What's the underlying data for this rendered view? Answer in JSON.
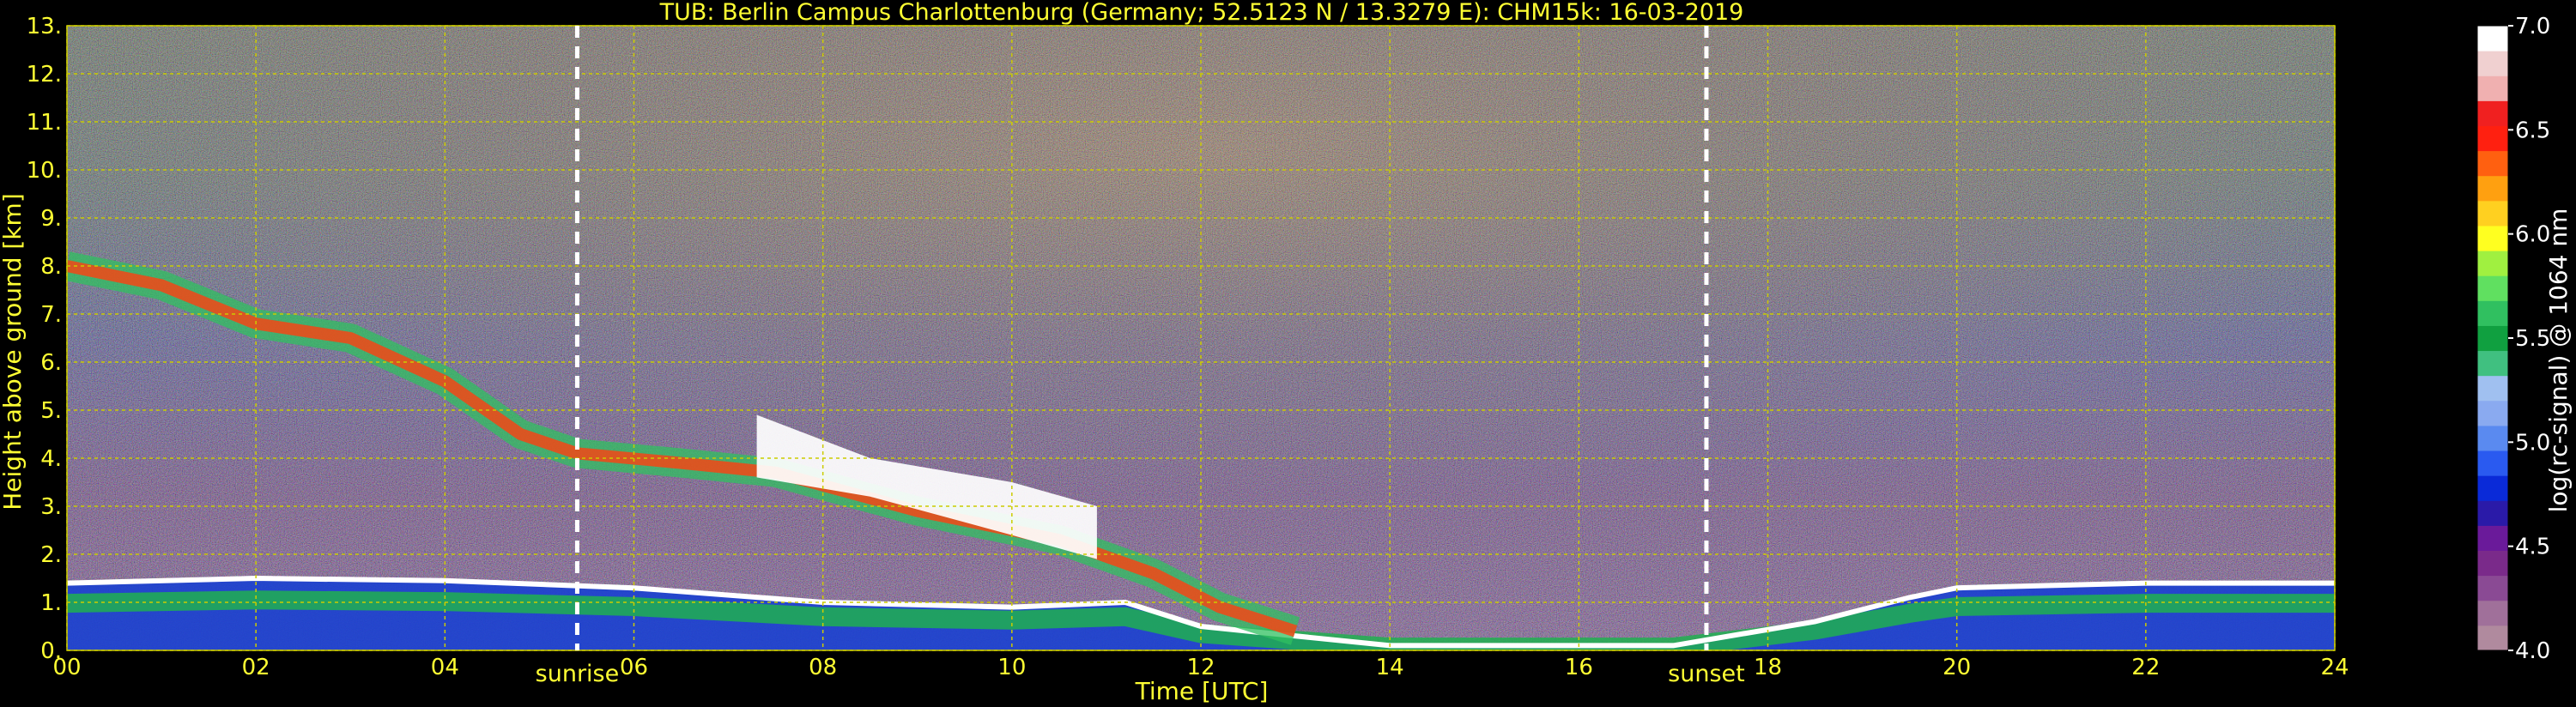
{
  "chart_data": {
    "type": "heatmap",
    "title": "TUB: Berlin Campus Charlottenburg (Germany; 52.5123 N / 13.3279 E):    CHM15k: 16-03-2019",
    "xlabel": "Time [UTC]",
    "ylabel": "Height above ground [km]",
    "xlim": [
      0,
      24
    ],
    "ylim": [
      0,
      13
    ],
    "x_ticks": [
      "00",
      "02",
      "04",
      "06",
      "08",
      "10",
      "12",
      "14",
      "16",
      "18",
      "20",
      "22",
      "24"
    ],
    "y_ticks": [
      "0.",
      "1.",
      "2.",
      "3.",
      "4.",
      "5.",
      "6.",
      "7.",
      "8.",
      "9.",
      "10.",
      "11.",
      "12.",
      "13."
    ],
    "grid": true,
    "annotations": [
      {
        "label": "sunrise",
        "x": 5.4
      },
      {
        "label": "sunset",
        "x": 17.35
      }
    ],
    "colorbar": {
      "label": "log(rc-signal) @ 1064 nm",
      "min": 4.0,
      "max": 7.0,
      "ticks": [
        "4.0",
        "4.5",
        "5.0",
        "5.5",
        "6.0",
        "6.5",
        "7.0"
      ],
      "colors": [
        "#b08a9e",
        "#a0709a",
        "#8a4a94",
        "#7a2a8a",
        "#6a1a9a",
        "#2a1aa8",
        "#0a2ad8",
        "#2a5af0",
        "#5a8af0",
        "#8aaaf0",
        "#a0c0f0",
        "#40c080",
        "#10a040",
        "#30c060",
        "#60e060",
        "#a0f040",
        "#ffff20",
        "#ffd020",
        "#ffa010",
        "#ff6010",
        "#ff2010",
        "#f02020",
        "#f0b0b0",
        "#f0d0d0",
        "#ffffff"
      ]
    },
    "features": [
      {
        "kind": "boundary_layer",
        "points": [
          [
            0,
            1.4
          ],
          [
            2,
            1.5
          ],
          [
            4,
            1.45
          ],
          [
            6,
            1.3
          ],
          [
            8,
            1.0
          ],
          [
            10,
            0.9
          ],
          [
            11.2,
            1.0
          ],
          [
            12,
            0.5
          ],
          [
            14,
            0.1
          ],
          [
            17,
            0.1
          ],
          [
            18.5,
            0.6
          ],
          [
            19.5,
            1.1
          ],
          [
            20,
            1.3
          ],
          [
            22,
            1.4
          ],
          [
            24,
            1.4
          ]
        ]
      },
      {
        "kind": "cirrus",
        "points": [
          [
            0,
            8.0
          ],
          [
            1,
            7.6
          ],
          [
            2,
            6.8
          ],
          [
            3,
            6.5
          ],
          [
            4,
            5.6
          ],
          [
            4.8,
            4.5
          ],
          [
            5.4,
            4.1
          ],
          [
            6.5,
            3.9
          ],
          [
            7.5,
            3.7
          ],
          [
            9,
            2.9
          ],
          [
            10.5,
            2.3
          ],
          [
            11.5,
            1.6
          ],
          [
            12.2,
            0.9
          ],
          [
            13,
            0.4
          ]
        ]
      },
      {
        "kind": "thick_cloud",
        "x_start": 7.3,
        "x_end": 10.9,
        "top": [
          [
            7.3,
            4.9
          ],
          [
            8.5,
            4.0
          ],
          [
            10,
            3.5
          ],
          [
            10.9,
            3.0
          ]
        ],
        "bottom": [
          [
            7.3,
            3.6
          ],
          [
            8.5,
            3.2
          ],
          [
            10,
            2.4
          ],
          [
            10.9,
            1.9
          ]
        ]
      }
    ]
  }
}
